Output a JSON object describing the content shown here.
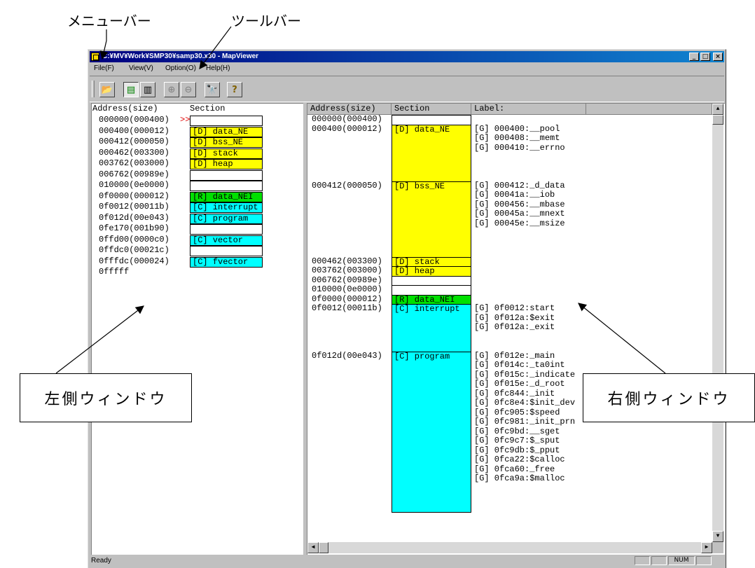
{
  "annotations": {
    "menubar_label": "メニューバー",
    "toolbar_label": "ツールバー",
    "left_window_label": "左側ウィンドウ",
    "right_window_label": "右側ウィンドウ"
  },
  "window": {
    "title": "C:¥MV¥Work¥SMP30¥samp30.x30 - MapViewer",
    "title_buttons": [
      "_",
      "□",
      "×"
    ]
  },
  "menu": [
    "File(F)",
    "View(V)",
    "Option(O)",
    "Help(H)"
  ],
  "toolbar": [
    {
      "name": "open-icon",
      "glyph": "📂"
    },
    {
      "name": "view-list-icon",
      "glyph": "▤"
    },
    {
      "name": "view-split-icon",
      "glyph": "▥"
    },
    {
      "name": "zoom-in-icon",
      "glyph": "⊕"
    },
    {
      "name": "zoom-out-icon",
      "glyph": "⊖"
    },
    {
      "name": "find-icon",
      "glyph": "🔭"
    },
    {
      "name": "help-icon",
      "glyph": "?"
    }
  ],
  "left_pane": {
    "headers": [
      "Address(size)",
      "Section"
    ],
    "rows": [
      {
        "addr": "000000(000400)",
        "marker": ">>",
        "section": "",
        "color": "#ffffff"
      },
      {
        "addr": "000400(000012)",
        "section": "[D] data_NE",
        "color": "#ffff00"
      },
      {
        "addr": "000412(000050)",
        "section": "[D] bss_NE",
        "color": "#ffff00"
      },
      {
        "addr": "000462(003300)",
        "section": "[D] stack",
        "color": "#ffff00"
      },
      {
        "addr": "003762(003000)",
        "section": "[D] heap",
        "color": "#ffff00"
      },
      {
        "addr": "006762(00989e)",
        "section": "",
        "color": "#ffffff"
      },
      {
        "addr": "010000(0e0000)",
        "section": "",
        "color": "#ffffff"
      },
      {
        "addr": "0f0000(000012)",
        "section": "[R] data_NEI",
        "color": "#00e000"
      },
      {
        "addr": "0f0012(00011b)",
        "section": "[C] interrupt",
        "color": "#00ffff"
      },
      {
        "addr": "0f012d(00e043)",
        "section": "[C] program",
        "color": "#00ffff"
      },
      {
        "addr": "0fe170(001b90)",
        "section": "",
        "color": "#ffffff"
      },
      {
        "addr": "0ffd00(0000c0)",
        "section": "[C] vector",
        "color": "#00ffff"
      },
      {
        "addr": "0ffdc0(00021c)",
        "section": "",
        "color": "#ffffff"
      },
      {
        "addr": "0fffdc(000024)",
        "section": "[C] fvector",
        "color": "#00ffff"
      },
      {
        "addr": "0fffff",
        "section": "",
        "color": ""
      }
    ]
  },
  "right_pane": {
    "headers": [
      "Address(size)",
      "Section",
      "Label:"
    ],
    "blocks": [
      {
        "addr": "000000(000400)",
        "section": "",
        "color": "#ffffff",
        "rows": 1,
        "labels": []
      },
      {
        "addr": "000400(000012)",
        "section": "[D] data_NE",
        "color": "#ffff00",
        "rows": 6,
        "labels": [
          "[G] 000400:__pool",
          "[G] 000408:__memt",
          "[G] 000410:__errno"
        ]
      },
      {
        "addr": "000412(000050)",
        "section": "[D] bss_NE",
        "color": "#ffff00",
        "rows": 8,
        "labels": [
          "[G] 000412:_d_data",
          "[G] 00041a:__iob",
          "[G] 000456:__mbase",
          "[G] 00045a:__mnext",
          "[G] 00045e:__msize"
        ]
      },
      {
        "addr": "000462(003300)",
        "section": "[D] stack",
        "color": "#ffff00",
        "rows": 1,
        "labels": []
      },
      {
        "addr": "003762(003000)",
        "section": "[D] heap",
        "color": "#ffff00",
        "rows": 1,
        "labels": []
      },
      {
        "addr": "006762(00989e)",
        "section": "",
        "color": "#ffffff",
        "rows": 1,
        "labels": []
      },
      {
        "addr": "010000(0e0000)",
        "section": "",
        "color": "#ffffff",
        "rows": 1,
        "labels": []
      },
      {
        "addr": "0f0000(000012)",
        "section": "[R] data_NEI",
        "color": "#00e000",
        "rows": 1,
        "labels": []
      },
      {
        "addr": "0f0012(00011b)",
        "section": "[C] interrupt",
        "color": "#00ffff",
        "rows": 5,
        "labels": [
          "[G] 0f0012:start",
          "[G] 0f012a:$exit",
          "[G] 0f012a:_exit"
        ]
      },
      {
        "addr": "0f012d(00e043)",
        "section": "[C] program",
        "color": "#00ffff",
        "rows": 17,
        "labels": [
          "[G] 0f012e:_main",
          "[G] 0f014c:_ta0int",
          "[G] 0f015c:_indicate",
          "[G] 0f015e:_d_root",
          "[G] 0fc844:_init",
          "[G] 0fc8e4:$init_dev",
          "[G] 0fc905:$speed",
          "[G] 0fc981:_init_prn",
          "[G] 0fc9bd:__sget",
          "[G] 0fc9c7:$_sput",
          "[G] 0fc9db:$_pput",
          "[G] 0fca22:$calloc",
          "[G] 0fca60:_free",
          "[G] 0fca9a:$malloc"
        ]
      }
    ]
  },
  "status": {
    "text": "Ready",
    "indicators": [
      "",
      "",
      "NUM",
      ""
    ]
  },
  "colors": {
    "title_start": "#000080",
    "title_end": "#1084d0",
    "data": "#ffff00",
    "rom": "#00e000",
    "code": "#00ffff"
  }
}
